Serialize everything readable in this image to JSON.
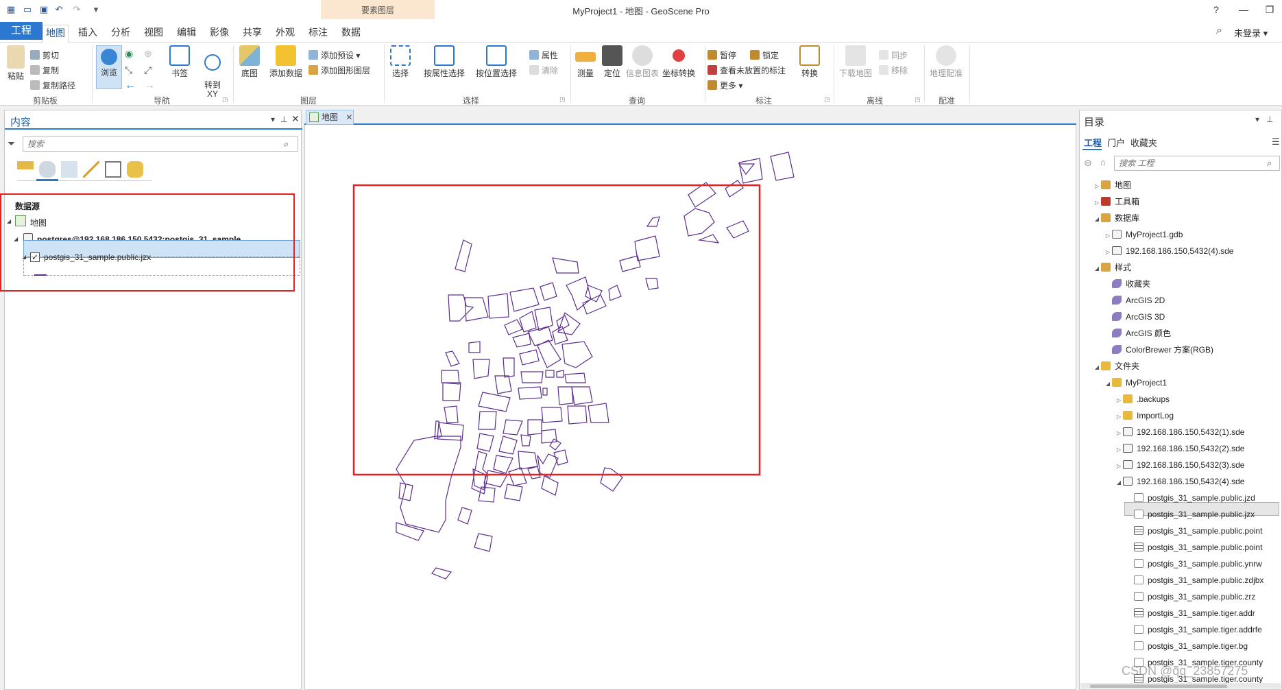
{
  "window": {
    "title": "MyProject1 - 地图 - GeoScene Pro",
    "help": "?",
    "minimize": "—",
    "restore": "❐"
  },
  "context_tab_group": "要素图层",
  "tabs": [
    "工程",
    "地图",
    "插入",
    "分析",
    "视图",
    "编辑",
    "影像",
    "共享",
    "外观",
    "标注",
    "数据"
  ],
  "active_tab": "地图",
  "signin": "未登录 ▾",
  "ribbon": {
    "clipboard": {
      "label": "剪贴板",
      "paste": "粘贴",
      "cut": "剪切",
      "copy": "复制",
      "copy_path": "复制路径"
    },
    "navigate": {
      "label": "导航",
      "explore": "浏览",
      "bookmarks": "书签",
      "goto_xy": "转到\nXY"
    },
    "layer": {
      "label": "图层",
      "basemap": "底图",
      "add_data": "添加数据",
      "add_preset": "添加预设 ▾",
      "add_graphics_layer": "添加图形图层"
    },
    "selection": {
      "label": "选择",
      "select": "选择",
      "select_by_attr": "按属性选择",
      "select_by_loc": "按位置选择",
      "attributes": "属性",
      "clear": "清除"
    },
    "inquiry": {
      "label": "查询",
      "measure": "测量",
      "locate": "定位",
      "infographics": "信息图表",
      "convert_coords": "坐标转换"
    },
    "labeling": {
      "label": "标注",
      "pause": "暂停",
      "lock": "锁定",
      "unplaced": "查看未放置的标注",
      "more": "更多 ▾",
      "convert": "转换"
    },
    "offline": {
      "label": "离线",
      "download_map": "下载地图",
      "sync": "同步",
      "remove": "移除"
    },
    "georef": {
      "label": "配准",
      "georeference": "地理配准"
    }
  },
  "contents": {
    "title": "内容",
    "search_placeholder": "搜索",
    "section": "数据源",
    "map": "地图",
    "connection": "postgres@192.168.186.150,5432:postgis_31_sample",
    "layer": "postgis_31_sample.public.jzx",
    "layer_visible": true
  },
  "map_view": {
    "tab": "地图"
  },
  "catalog": {
    "title": "目录",
    "tabs": [
      "工程",
      "门户",
      "收藏夹"
    ],
    "search_placeholder": "搜索 工程",
    "items": [
      {
        "label": "地图",
        "depth": 0,
        "twisty": "▷",
        "icon": "map-folder",
        "color": "#d9a441"
      },
      {
        "label": "工具箱",
        "depth": 0,
        "twisty": "▷",
        "icon": "toolbox",
        "color": "#c0392b"
      },
      {
        "label": "数据库",
        "depth": 0,
        "twisty": "◢",
        "icon": "database-folder",
        "color": "#d9a441"
      },
      {
        "label": "MyProject1.gdb",
        "depth": 1,
        "twisty": "▷",
        "icon": "gdb",
        "color": "#777777"
      },
      {
        "label": "192.168.186.150,5432(4).sde",
        "depth": 1,
        "twisty": "▷",
        "icon": "sde",
        "color": "#555555"
      },
      {
        "label": "样式",
        "depth": 0,
        "twisty": "◢",
        "icon": "styles-folder",
        "color": "#d9a441"
      },
      {
        "label": "收藏夹",
        "depth": 1,
        "twisty": "",
        "icon": "style",
        "color": "#8e7cc3"
      },
      {
        "label": "ArcGIS 2D",
        "depth": 1,
        "twisty": "",
        "icon": "style",
        "color": "#8e7cc3"
      },
      {
        "label": "ArcGIS 3D",
        "depth": 1,
        "twisty": "",
        "icon": "style",
        "color": "#8e7cc3"
      },
      {
        "label": "ArcGIS 颜色",
        "depth": 1,
        "twisty": "",
        "icon": "style",
        "color": "#8e7cc3"
      },
      {
        "label": "ColorBrewer 方案(RGB)",
        "depth": 1,
        "twisty": "",
        "icon": "style",
        "color": "#8e7cc3"
      },
      {
        "label": "文件夹",
        "depth": 0,
        "twisty": "◢",
        "icon": "folder",
        "color": "#e8b93a"
      },
      {
        "label": "MyProject1",
        "depth": 1,
        "twisty": "◢",
        "icon": "folder",
        "color": "#e8b93a"
      },
      {
        "label": ".backups",
        "depth": 2,
        "twisty": "▷",
        "icon": "folder",
        "color": "#e8b93a"
      },
      {
        "label": "ImportLog",
        "depth": 2,
        "twisty": "▷",
        "icon": "folder",
        "color": "#e8b93a"
      },
      {
        "label": "192.168.186.150,5432(1).sde",
        "depth": 2,
        "twisty": "▷",
        "icon": "sde",
        "color": "#555555"
      },
      {
        "label": "192.168.186.150,5432(2).sde",
        "depth": 2,
        "twisty": "▷",
        "icon": "sde",
        "color": "#555555"
      },
      {
        "label": "192.168.186.150,5432(3).sde",
        "depth": 2,
        "twisty": "▷",
        "icon": "sde",
        "color": "#555555"
      },
      {
        "label": "192.168.186.150,5432(4).sde",
        "depth": 2,
        "twisty": "◢",
        "icon": "sde",
        "color": "#555555"
      },
      {
        "label": "postgis_31_sample.public.jzd",
        "depth": 3,
        "twisty": "",
        "icon": "feature-class",
        "color": "#888888"
      },
      {
        "label": "postgis_31_sample.public.jzx",
        "depth": 3,
        "twisty": "",
        "icon": "feature-class",
        "color": "#888888"
      },
      {
        "label": "postgis_31_sample.public.point",
        "depth": 3,
        "twisty": "",
        "icon": "table",
        "color": "#666666"
      },
      {
        "label": "postgis_31_sample.public.point",
        "depth": 3,
        "twisty": "",
        "icon": "table",
        "color": "#666666"
      },
      {
        "label": "postgis_31_sample.public.ynrw",
        "depth": 3,
        "twisty": "",
        "icon": "feature-class",
        "color": "#888888"
      },
      {
        "label": "postgis_31_sample.public.zdjbx",
        "depth": 3,
        "twisty": "",
        "icon": "feature-class",
        "color": "#888888"
      },
      {
        "label": "postgis_31_sample.public.zrz",
        "depth": 3,
        "twisty": "",
        "icon": "feature-class",
        "color": "#888888"
      },
      {
        "label": "postgis_31_sample.tiger.addr",
        "depth": 3,
        "twisty": "",
        "icon": "table",
        "color": "#666666"
      },
      {
        "label": "postgis_31_sample.tiger.addrfe",
        "depth": 3,
        "twisty": "",
        "icon": "feature-class",
        "color": "#888888"
      },
      {
        "label": "postgis_31_sample.tiger.bg",
        "depth": 3,
        "twisty": "",
        "icon": "feature-class",
        "color": "#888888"
      },
      {
        "label": "postgis_31_sample.tiger.county",
        "depth": 3,
        "twisty": "",
        "icon": "feature-class",
        "color": "#888888"
      },
      {
        "label": "postgis_31_sample.tiger.county",
        "depth": 3,
        "twisty": "",
        "icon": "table",
        "color": "#666666"
      }
    ]
  },
  "watermark": "CSDN @qq_23857275",
  "colors": {
    "accent": "#2b78d0",
    "feature_outline": "#5b2d8e",
    "annotation_red": "#e52020"
  }
}
